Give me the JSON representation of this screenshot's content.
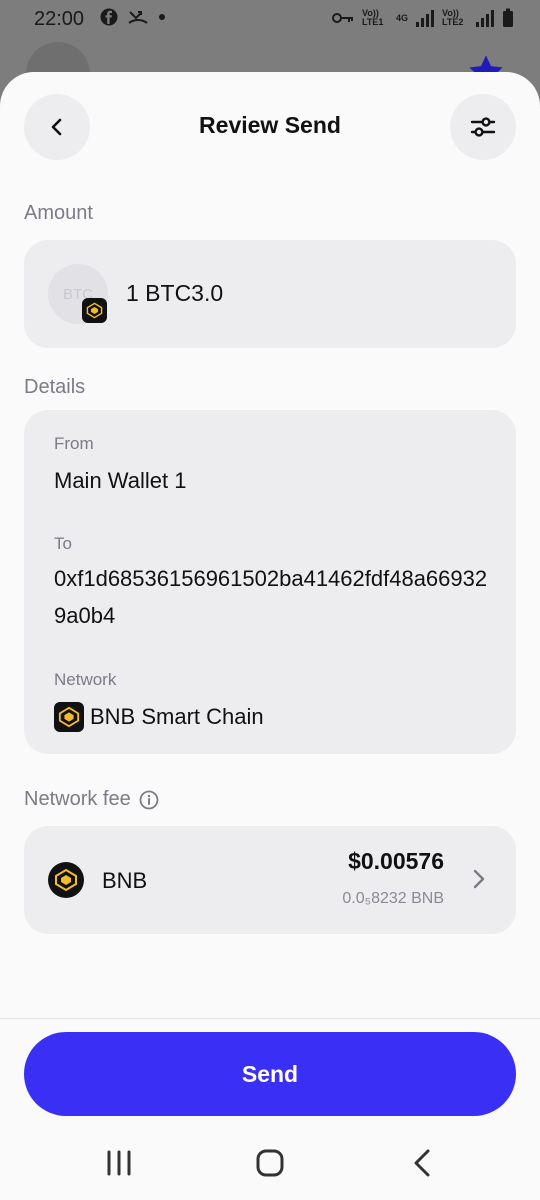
{
  "status_bar": {
    "time": "22:00",
    "lte1": "Vo)) LTE1",
    "net4g": "4G",
    "lte2": "Vo)) LTE2"
  },
  "header": {
    "title": "Review Send",
    "back_icon": "chevron-left-icon",
    "settings_icon": "sliders-icon"
  },
  "amount": {
    "label": "Amount",
    "coin_placeholder": "BTC",
    "value": "1 BTC3.0"
  },
  "details": {
    "label": "Details",
    "from_label": "From",
    "from_value": "Main Wallet 1",
    "to_label": "To",
    "to_value": "0xf1d68536156961502ba41462fdf48a669329a0b4",
    "network_label": "Network",
    "network_value": "BNB Smart Chain"
  },
  "fee": {
    "label": "Network fee",
    "coin": "BNB",
    "usd": "$0.00576",
    "amount": "0.0₅8232 BNB"
  },
  "actions": {
    "send_label": "Send"
  },
  "colors": {
    "accent": "#3a2ff5",
    "bnb_gold": "#f3ba2f",
    "card": "#ededf0"
  }
}
